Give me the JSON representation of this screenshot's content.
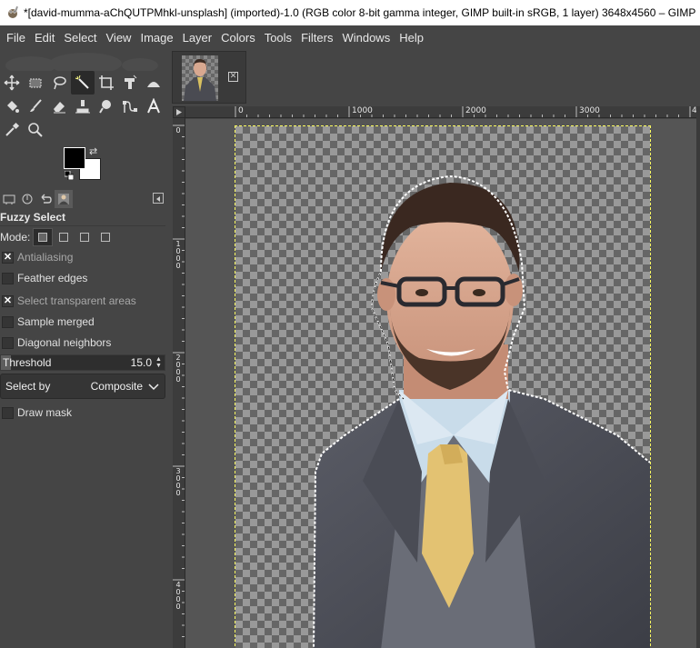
{
  "window": {
    "title": "*[david-mumma-aChQUTPMhkl-unsplash] (imported)-1.0 (RGB color 8-bit gamma integer, GIMP built-in sRGB, 1 layer) 3648x4560 – GIMP"
  },
  "menubar": {
    "items": [
      "File",
      "Edit",
      "Select",
      "View",
      "Image",
      "Layer",
      "Colors",
      "Tools",
      "Filters",
      "Windows",
      "Help"
    ]
  },
  "toolbox": {
    "tools": [
      "move-tool",
      "rect-select-tool",
      "lasso-tool",
      "fuzzy-select-tool",
      "crop-tool",
      "unified-transform-tool",
      "warp-transform-tool",
      "bucket-fill-tool",
      "paintbrush-tool",
      "eraser-tool",
      "clone-tool",
      "smudge-tool",
      "paths-tool",
      "text-tool",
      "color-picker-tool",
      "zoom-tool"
    ],
    "active_tool": "fuzzy-select-tool",
    "foreground_color": "#000000",
    "background_color": "#ffffff"
  },
  "tool_options": {
    "title": "Fuzzy Select",
    "mode_label": "Mode:",
    "options": [
      {
        "label": "Antialiasing",
        "checked": true,
        "dim": true
      },
      {
        "label": "Feather edges",
        "checked": false,
        "dim": false
      },
      {
        "label": "Select transparent areas",
        "checked": true,
        "dim": true
      },
      {
        "label": "Sample merged",
        "checked": false,
        "dim": false
      },
      {
        "label": "Diagonal neighbors",
        "checked": false,
        "dim": false
      }
    ],
    "threshold": {
      "label": "Threshold",
      "value": "15.0",
      "fraction": 0.06
    },
    "select_by": {
      "label": "Select by",
      "value": "Composite"
    },
    "draw_mask": {
      "label": "Draw mask",
      "checked": false
    }
  },
  "rulers": {
    "horizontal": [
      "0",
      "1000",
      "2000",
      "3000",
      "4"
    ],
    "vertical": [
      "0",
      "1000",
      "2000",
      "3000",
      "4000"
    ]
  },
  "colors": {
    "ui_bg": "#454545",
    "selection_marching_ants": "#ffffff",
    "layer_boundary": "#ffff60"
  }
}
